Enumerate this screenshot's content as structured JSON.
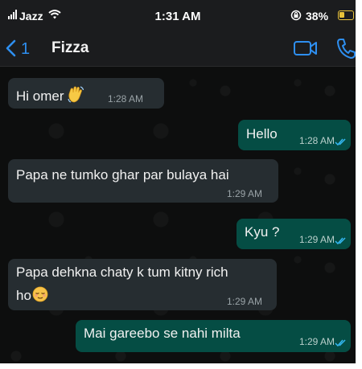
{
  "status_bar": {
    "carrier": "Jazz",
    "time": "1:31 AM",
    "battery": "38%",
    "battery_level": 0.38
  },
  "header": {
    "back_count": "1",
    "contact_name": "Fizza"
  },
  "messages": [
    {
      "direction": "in",
      "text": "Hi omer",
      "emoji": "waving-hand",
      "time": "1:28 AM"
    },
    {
      "direction": "out",
      "text": "Hello",
      "time": "1:28 AM",
      "status": "read"
    },
    {
      "direction": "in",
      "text": "Papa ne tumko ghar par bulaya hai",
      "time": "1:29 AM"
    },
    {
      "direction": "out",
      "text": "Kyu ?",
      "time": "1:29 AM",
      "status": "read"
    },
    {
      "direction": "in",
      "text_line1": "Papa dehkna chaty k tum kitny rich",
      "text_line2": "ho",
      "emoji": "relieved-face",
      "time": "1:29 AM"
    },
    {
      "direction": "out",
      "text": "Mai gareebo se nahi milta",
      "time": "1:29 AM",
      "status": "read"
    }
  ],
  "colors": {
    "accent": "#2e8ff0",
    "incoming_bubble": "#262d31",
    "outgoing_bubble": "#054d44",
    "read_ticks": "#34b7f1",
    "battery": "#e8c23a"
  }
}
